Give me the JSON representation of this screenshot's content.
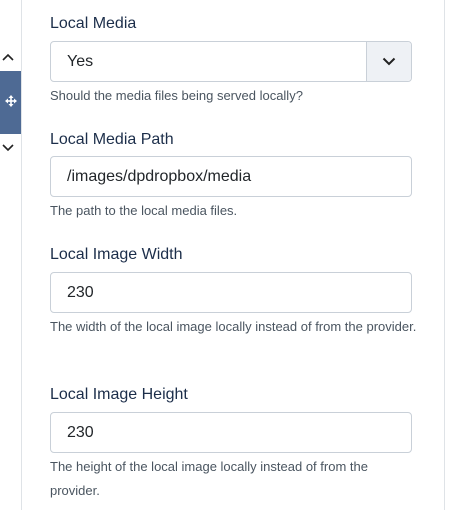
{
  "fields": [
    {
      "label": "Local Media",
      "value": "Yes",
      "help": "Should the media files being served locally?"
    },
    {
      "label": "Local Media Path",
      "value": "/images/dpdropbox/media",
      "help": "The path to the local media files."
    },
    {
      "label": "Local Image Width",
      "value": "230",
      "help": "The width of the local image locally instead of from the provider."
    },
    {
      "label": "Local Image Height",
      "value": "230",
      "help": "The height of the local image locally instead of from the provider."
    }
  ],
  "icons": {
    "up": "chevron-up-icon",
    "move": "move-arrows-icon",
    "down": "chevron-down-icon",
    "select_caret": "chevron-down-icon"
  },
  "colors": {
    "handle": "#4e6a94",
    "label": "#1c2e4a",
    "help": "#4a5560",
    "border": "#c9d0d8"
  }
}
